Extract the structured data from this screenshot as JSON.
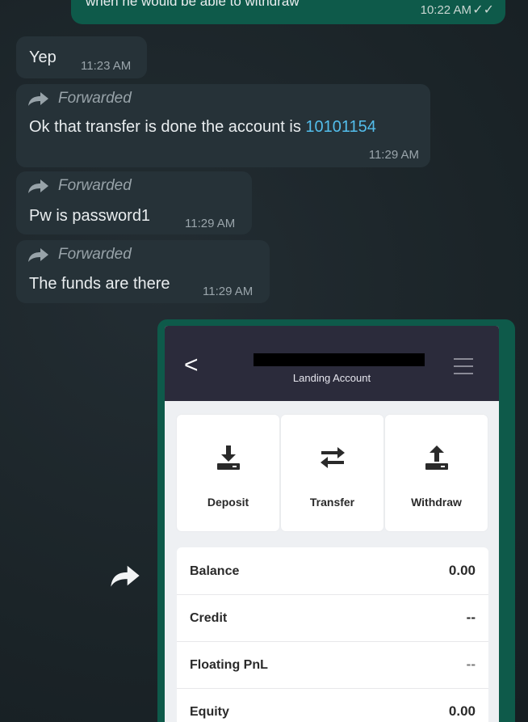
{
  "top_message": {
    "partial_text": "when he would be able to withdraw",
    "time": "10:22 AM"
  },
  "messages": [
    {
      "text": "Yep",
      "time": "11:23 AM",
      "forwarded": false
    },
    {
      "forwarded_label": "Forwarded",
      "text_prefix": "Ok that transfer is done the account is ",
      "link": "10101154",
      "time": "11:29 AM"
    },
    {
      "forwarded_label": "Forwarded",
      "text": "Pw is password1",
      "time": "11:29 AM"
    },
    {
      "forwarded_label": "Forwarded",
      "text": "The funds are there",
      "time": "11:29 AM"
    }
  ],
  "screenshot": {
    "header": {
      "back": "<",
      "subtitle": "Landing Account"
    },
    "actions": [
      {
        "label": "Deposit",
        "icon": "download-tray-icon"
      },
      {
        "label": "Transfer",
        "icon": "transfer-arrows-icon"
      },
      {
        "label": "Withdraw",
        "icon": "upload-tray-icon"
      }
    ],
    "stats": [
      {
        "label": "Balance",
        "value": "0.00"
      },
      {
        "label": "Credit",
        "value": "--"
      },
      {
        "label": "Floating PnL",
        "value": "--"
      },
      {
        "label": "Equity",
        "value": "0.00"
      }
    ]
  },
  "colors": {
    "chat_bg": "#1d262b",
    "incoming_bubble": "#263238",
    "outgoing_bubble": "#0e5a4a",
    "link": "#53bdeb",
    "app_header": "#2b2b3b"
  }
}
